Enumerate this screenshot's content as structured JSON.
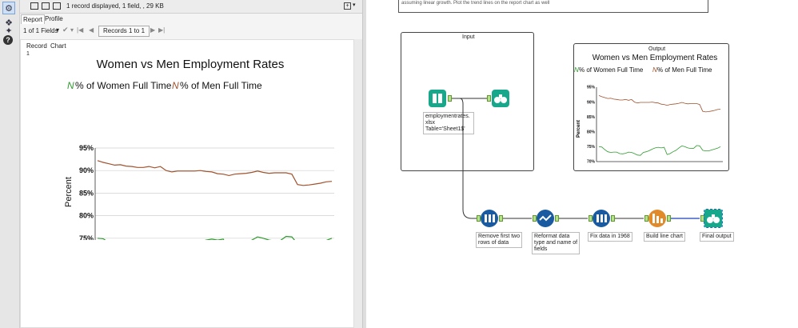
{
  "results": {
    "status": "1 record displayed, 1 field, , 29 KB",
    "tabs": [
      "Report",
      "Profile"
    ],
    "fields_selector": "1 of 1 Fields",
    "records_button": "Records 1 to 1",
    "col_record": "Record",
    "col_chart": "Chart",
    "row_number": "1"
  },
  "chart_data": [
    {
      "type": "line",
      "title": "Women vs Men Employment Rates",
      "legend_position": "top",
      "series": [
        {
          "name": "% of Women Full Time",
          "color": "#2e9b2e",
          "values": [
            75,
            74.9,
            74.0,
            73.3,
            73.1,
            73.2,
            73.2,
            72.7,
            72.6,
            72.8,
            73.2,
            73.1,
            72.7,
            72.2,
            72.1,
            73.1,
            73.3,
            73.7,
            74.2,
            74.6,
            74.8,
            74.6,
            74.8,
            72.4,
            72.7,
            73.3,
            73.8,
            74.6,
            75.3,
            75.0,
            74.6,
            74.4,
            74.5,
            75.4,
            75.3,
            73.8,
            73.6,
            73.6,
            73.9,
            74.2,
            74.5,
            75.0
          ]
        },
        {
          "name": "% of Men Full Time",
          "color": "#a0522d",
          "values": [
            92.2,
            91.8,
            91.5,
            91.2,
            91.3,
            91.0,
            90.9,
            90.7,
            90.7,
            90.9,
            90.6,
            90.9,
            90.0,
            89.7,
            89.9,
            89.9,
            89.9,
            89.9,
            90.0,
            89.8,
            89.7,
            89.3,
            89.2,
            88.9,
            89.2,
            89.3,
            89.4,
            89.6,
            89.9,
            89.6,
            89.4,
            89.5,
            89.5,
            89.5,
            89.2,
            86.9,
            86.7,
            86.8,
            87.0,
            87.2,
            87.5,
            87.6
          ]
        }
      ],
      "ylabel": "Percent",
      "yticks": [
        "95%",
        "90%",
        "85%",
        "80%",
        "75%",
        "70%"
      ],
      "ylim": [
        70,
        95
      ],
      "grid": true
    }
  ],
  "canvas": {
    "top_note": "assuming linear growth. Plot the trend lines on the report chart as well",
    "input_title": "Input",
    "output_title": "Output",
    "input_tool_annotation": [
      "employmentrates.",
      "xlsx",
      "Table='Sheet1$'"
    ],
    "tools": [
      {
        "label": "Remove first two rows of data",
        "lines": [
          "Remove first two",
          "rows of data"
        ],
        "color": "#1a5aa0",
        "icon": "formula-icon"
      },
      {
        "label": "Reformat data type and name of fields",
        "lines": [
          "Reformat data",
          "type and name of",
          "fields"
        ],
        "color": "#1a5aa0",
        "icon": "select-icon"
      },
      {
        "label": "Fix data in 1968",
        "lines": [
          "Fix data in 1968"
        ],
        "color": "#1a5aa0",
        "icon": "formula-icon"
      },
      {
        "label": "Build line chart",
        "lines": [
          "Build line chart"
        ],
        "color": "#e08a2a",
        "icon": "chart-icon"
      },
      {
        "label": "Final output",
        "lines": [
          "Final output"
        ],
        "color": "#17a88c",
        "icon": "browse-icon"
      }
    ],
    "output_preview": {
      "title": "Women vs Men Employment Rates",
      "legend": [
        "% of Women Full Time",
        "% of Men Full Time"
      ],
      "ylabel": "Percent",
      "yticks": [
        "95%",
        "90%",
        "85%",
        "80%",
        "75%",
        "70%"
      ]
    }
  }
}
